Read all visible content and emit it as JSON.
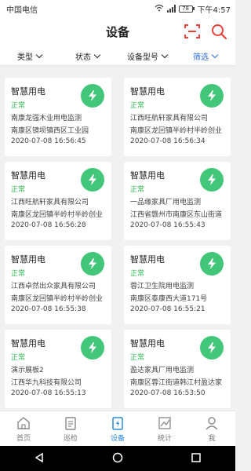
{
  "status_bar": {
    "carrier": "中国电信",
    "battery": "78",
    "time": "下午4:57"
  },
  "header": {
    "title": "设备"
  },
  "filters": [
    {
      "label": "类型"
    },
    {
      "label": "状态"
    },
    {
      "label": "设备型号"
    },
    {
      "label": "筛选"
    }
  ],
  "devices": [
    {
      "name": "智慧用电",
      "status": "正常",
      "line1": "南康龙强木业用电监测",
      "line2": "南康区镜坝镇西区工业园",
      "time": "2020-07-08 16:56:45"
    },
    {
      "name": "智慧用电",
      "status": "正常",
      "line1": "江西旺航轩家具有限公司",
      "line2": "南康区龙回镇半岭村半岭创业",
      "time": "2020-07-08 16:56:34"
    },
    {
      "name": "智慧用电",
      "status": "正常",
      "line1": "江西旺航轩家具有限公司",
      "line2": "南康区龙回镇半岭村半岭创业",
      "time": "2020-07-08 16:56:28"
    },
    {
      "name": "智慧用电",
      "status": "正常",
      "line1": "一品缘家具厂用电监测",
      "line2": "江西省赣州市南康区东山街道",
      "time": "2020-07-08 16:55:43"
    },
    {
      "name": "智慧用电",
      "status": "正常",
      "line1": "江西卓然出众家具有限公司",
      "line2": "南康区龙回镇半岭村半岭创业",
      "time": "2020-07-08 16:55:38"
    },
    {
      "name": "智慧用电",
      "status": "正常",
      "line1": "蓉江卫生院用电监测",
      "line2": "南康区泰康西大道171号",
      "time": "2020-07-08 16:55:21"
    },
    {
      "name": "智慧用电",
      "status": "正常",
      "line1": "演示展板2",
      "line2": "江西华九科技有限公司",
      "time": "2020-07-08 16:55:13"
    },
    {
      "name": "智慧用电",
      "status": "正常",
      "line1": "盈达家具厂用电监测",
      "line2": "南康区蓉江街道韩江村盈达家",
      "time": "2020-07-08 16:53:50"
    }
  ],
  "tabs": [
    {
      "label": "首页"
    },
    {
      "label": "巡检"
    },
    {
      "label": "设备"
    },
    {
      "label": "统计"
    },
    {
      "label": "我"
    }
  ],
  "colors": {
    "accent": "#2a8ae0",
    "status_green": "#2fb94f",
    "bolt_bg": "#42c67a",
    "scan_red": "#e8413a"
  }
}
